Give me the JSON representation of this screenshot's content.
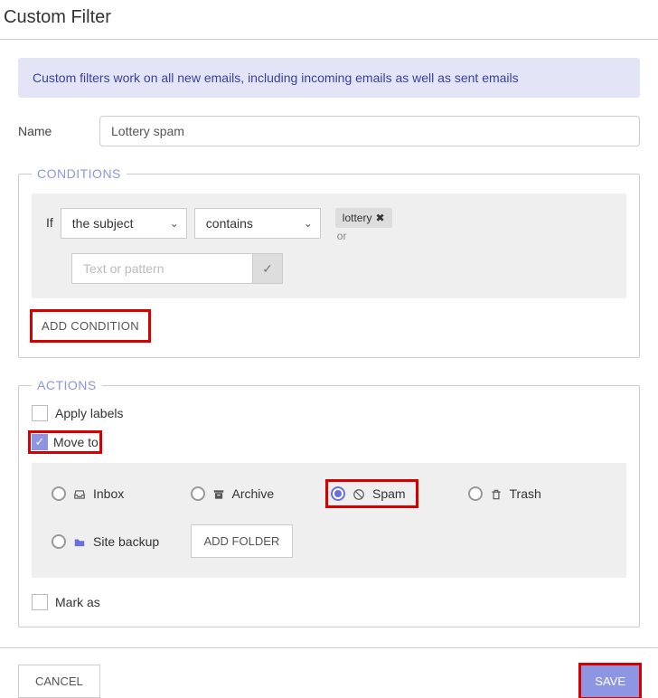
{
  "header": {
    "title": "Custom Filter"
  },
  "banner": {
    "text": "Custom filters work on all new emails, including incoming emails as well as sent emails"
  },
  "nameRow": {
    "label": "Name",
    "value": "Lottery spam"
  },
  "conditions": {
    "legend": "CONDITIONS",
    "ifLabel": "If",
    "fieldSelect": "the subject",
    "matchSelect": "contains",
    "tags": [
      {
        "text": "lottery"
      }
    ],
    "orText": "or",
    "patternPlaceholder": "Text or pattern",
    "addConditionLabel": "ADD CONDITION"
  },
  "actions": {
    "legend": "ACTIONS",
    "applyLabels": {
      "label": "Apply labels",
      "checked": false
    },
    "moveTo": {
      "label": "Move to",
      "checked": true
    },
    "folders": [
      {
        "id": "inbox",
        "label": "Inbox",
        "icon": "inbox",
        "selected": false
      },
      {
        "id": "archive",
        "label": "Archive",
        "icon": "archive",
        "selected": false
      },
      {
        "id": "spam",
        "label": "Spam",
        "icon": "ban",
        "selected": true
      },
      {
        "id": "trash",
        "label": "Trash",
        "icon": "trash",
        "selected": false
      },
      {
        "id": "backup",
        "label": "Site backup",
        "icon": "folder",
        "selected": false
      }
    ],
    "addFolderLabel": "ADD FOLDER",
    "markAs": {
      "label": "Mark as",
      "checked": false
    }
  },
  "footer": {
    "cancel": "CANCEL",
    "save": "SAVE"
  }
}
